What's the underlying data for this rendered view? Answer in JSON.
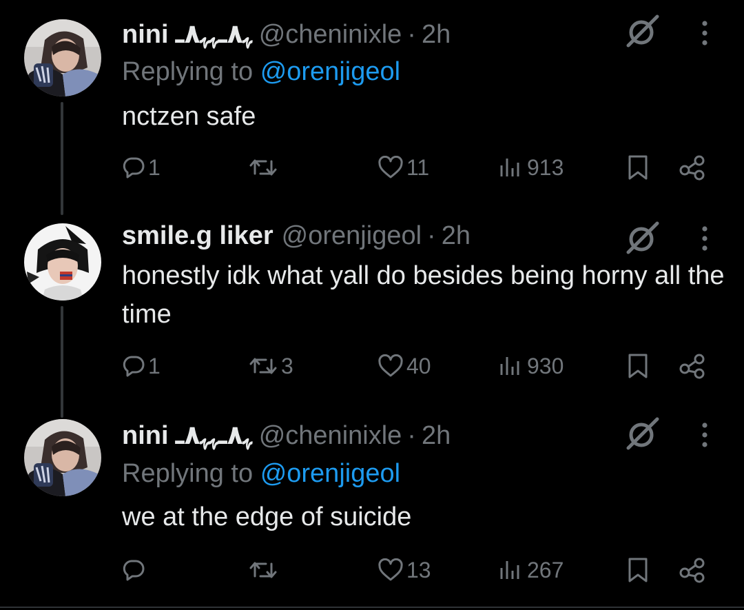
{
  "colors": {
    "background": "#000000",
    "text_primary": "#e7e9ea",
    "text_secondary": "#71767b",
    "link": "#1d9bf0",
    "thread_line": "#333639"
  },
  "tweets": [
    {
      "display_name": "nini",
      "name_decoration": "ﮩ٨ـﮩﮩ٨ـ",
      "handle": "@cheninixle",
      "separator": "·",
      "time": "2h",
      "replying_prefix": "Replying to",
      "replying_to": "@orenjigeol",
      "text": "nctzen safe",
      "avatar_icon": "profile-photo",
      "replies": "1",
      "reposts": "",
      "likes": "11",
      "views": "913"
    },
    {
      "display_name": "smile.g liker",
      "handle": "@orenjigeol",
      "separator": "·",
      "time": "2h",
      "text": "honestly idk what yall do besides being horny all the time",
      "avatar_icon": "profile-photo",
      "replies": "1",
      "reposts": "3",
      "likes": "40",
      "views": "930"
    },
    {
      "display_name": "nini",
      "name_decoration": "ﮩ٨ـﮩﮩ٨ـ",
      "handle": "@cheninixle",
      "separator": "·",
      "time": "2h",
      "replying_prefix": "Replying to",
      "replying_to": "@orenjigeol",
      "text": "we at the edge of suicide",
      "avatar_icon": "profile-photo",
      "replies": "",
      "reposts": "",
      "likes": "13",
      "views": "267"
    }
  ],
  "icons": {
    "reply": "speech-bubble-icon",
    "repost": "repost-arrows-icon",
    "like": "heart-icon",
    "views": "bar-chart-icon",
    "bookmark": "bookmark-icon",
    "share": "share-nodes-icon",
    "grok": "grok-slash-icon",
    "more": "vertical-dots-icon"
  }
}
